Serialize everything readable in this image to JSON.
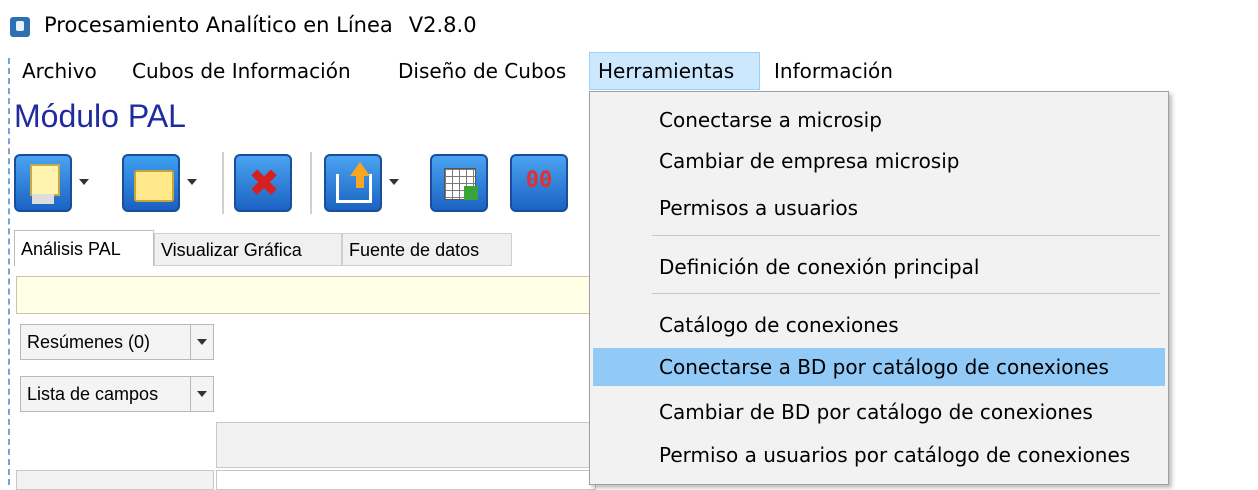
{
  "window": {
    "title": "Procesamiento Analítico en Línea",
    "version": "V2.8.0"
  },
  "menubar": {
    "items": [
      {
        "label": "Archivo"
      },
      {
        "label": "Cubos de Información"
      },
      {
        "label": "Diseño de Cubos"
      },
      {
        "label": "Herramientas",
        "active": true
      },
      {
        "label": "Información"
      }
    ]
  },
  "module": {
    "title": "Módulo PAL"
  },
  "toolbar": {
    "buttons": [
      {
        "icon": "save-icon"
      },
      {
        "icon": "open-folder-icon"
      },
      {
        "icon": "delete-icon",
        "glyph": "✖"
      },
      {
        "icon": "export-icon"
      },
      {
        "icon": "grid-icon"
      },
      {
        "icon": "link-icon",
        "glyph": "00"
      }
    ]
  },
  "tabs": [
    {
      "label": "Análisis PAL",
      "active": true
    },
    {
      "label": "Visualizar Gráfica"
    },
    {
      "label": "Fuente de datos"
    }
  ],
  "panel": {
    "summaries_label": "Resúmenes (0)",
    "fields_label": "Lista de campos"
  },
  "herramientas_menu": {
    "groups": [
      [
        "Conectarse a microsip",
        "Cambiar de empresa microsip",
        "Permisos a usuarios"
      ],
      [
        "Definición de conexión principal"
      ],
      [
        "Catálogo de conexiones",
        "Conectarse a BD por catálogo de conexiones",
        "Cambiar de BD por catálogo de conexiones",
        "Permiso a usuarios por catálogo de conexiones"
      ]
    ],
    "items": {
      "i0": "Conectarse a microsip",
      "i1": "Cambiar de empresa microsip",
      "i2": "Permisos a usuarios",
      "i3": "Definición de conexión principal",
      "i4": "Catálogo de conexiones",
      "i5": "Conectarse a BD por catálogo de conexiones",
      "i6": "Cambiar de BD por catálogo de conexiones",
      "i7": "Permiso a usuarios por catálogo de conexiones"
    },
    "highlighted": "Conectarse a BD por catálogo de conexiones"
  },
  "colors": {
    "module_title": "#1f2b9e",
    "menu_highlight": "#91c9f7",
    "active_menu": "#cce8ff",
    "filter_bg": "#ffffe6"
  }
}
